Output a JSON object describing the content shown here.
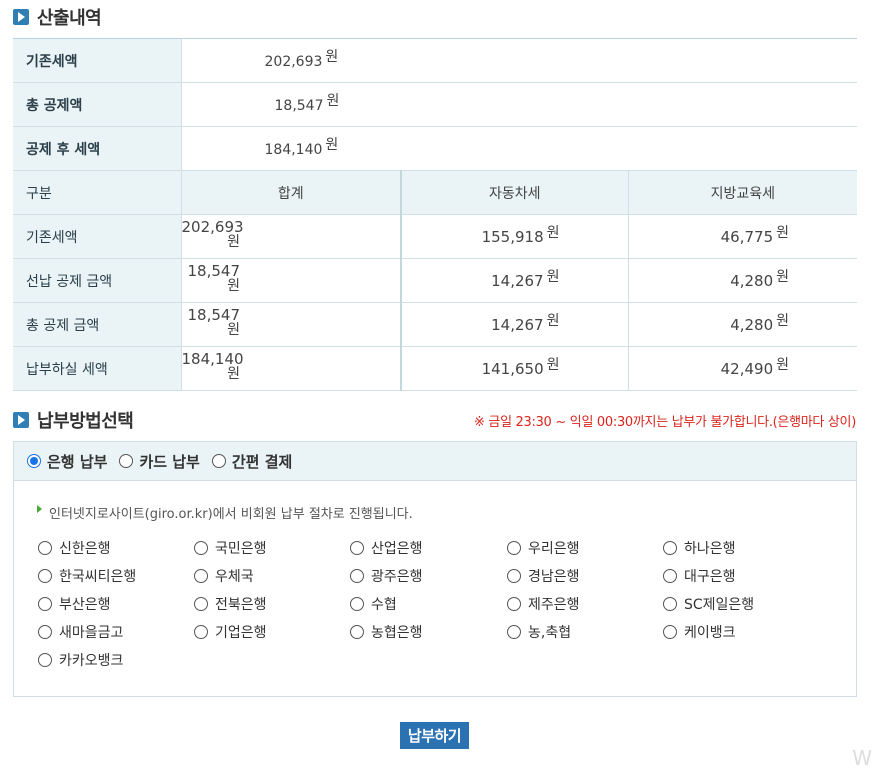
{
  "calc": {
    "title": "산출내역",
    "unit": "원",
    "summary": [
      {
        "label": "기존세액",
        "value": "202,693"
      },
      {
        "label": "총 공제액",
        "value": "18,547"
      },
      {
        "label": "공제 후 세액",
        "value": "184,140"
      }
    ],
    "columns": [
      "구분",
      "합계",
      "자동차세",
      "지방교육세"
    ],
    "rows": [
      {
        "label": "기존세액",
        "total": "202,693",
        "car": "155,918",
        "edu": "46,775"
      },
      {
        "label": "선납 공제 금액",
        "total": "18,547",
        "car": "14,267",
        "edu": "4,280"
      },
      {
        "label": "총 공제 금액",
        "total": "18,547",
        "car": "14,267",
        "edu": "4,280"
      },
      {
        "label": "납부하실 세액",
        "total": "184,140",
        "car": "141,650",
        "edu": "42,490"
      }
    ]
  },
  "payment": {
    "title": "납부방법선택",
    "notice": "※ 금일 23:30 ~ 익일 00:30까지는 납부가 불가합니다.(은행마다 상이)",
    "methods": [
      {
        "label": "은행 납부",
        "selected": true
      },
      {
        "label": "카드 납부",
        "selected": false
      },
      {
        "label": "간편 결제",
        "selected": false
      }
    ],
    "info": "인터넷지로사이트(giro.or.kr)에서 비회원 납부 절차로 진행됩니다.",
    "banks": [
      "신한은행",
      "국민은행",
      "산업은행",
      "우리은행",
      "하나은행",
      "한국씨티은행",
      "우체국",
      "광주은행",
      "경남은행",
      "대구은행",
      "부산은행",
      "전북은행",
      "수협",
      "제주은행",
      "SC제일은행",
      "새마을금고",
      "기업은행",
      "농협은행",
      "농,축협",
      "케이뱅크",
      "카카오뱅크"
    ]
  },
  "submit_label": "납부하기",
  "watermark": "W",
  "colors": {
    "accent": "#2b72b3",
    "header_bg": "#eaf3f5",
    "notice": "#d9251d",
    "radio_selected": "#1a73e8"
  }
}
